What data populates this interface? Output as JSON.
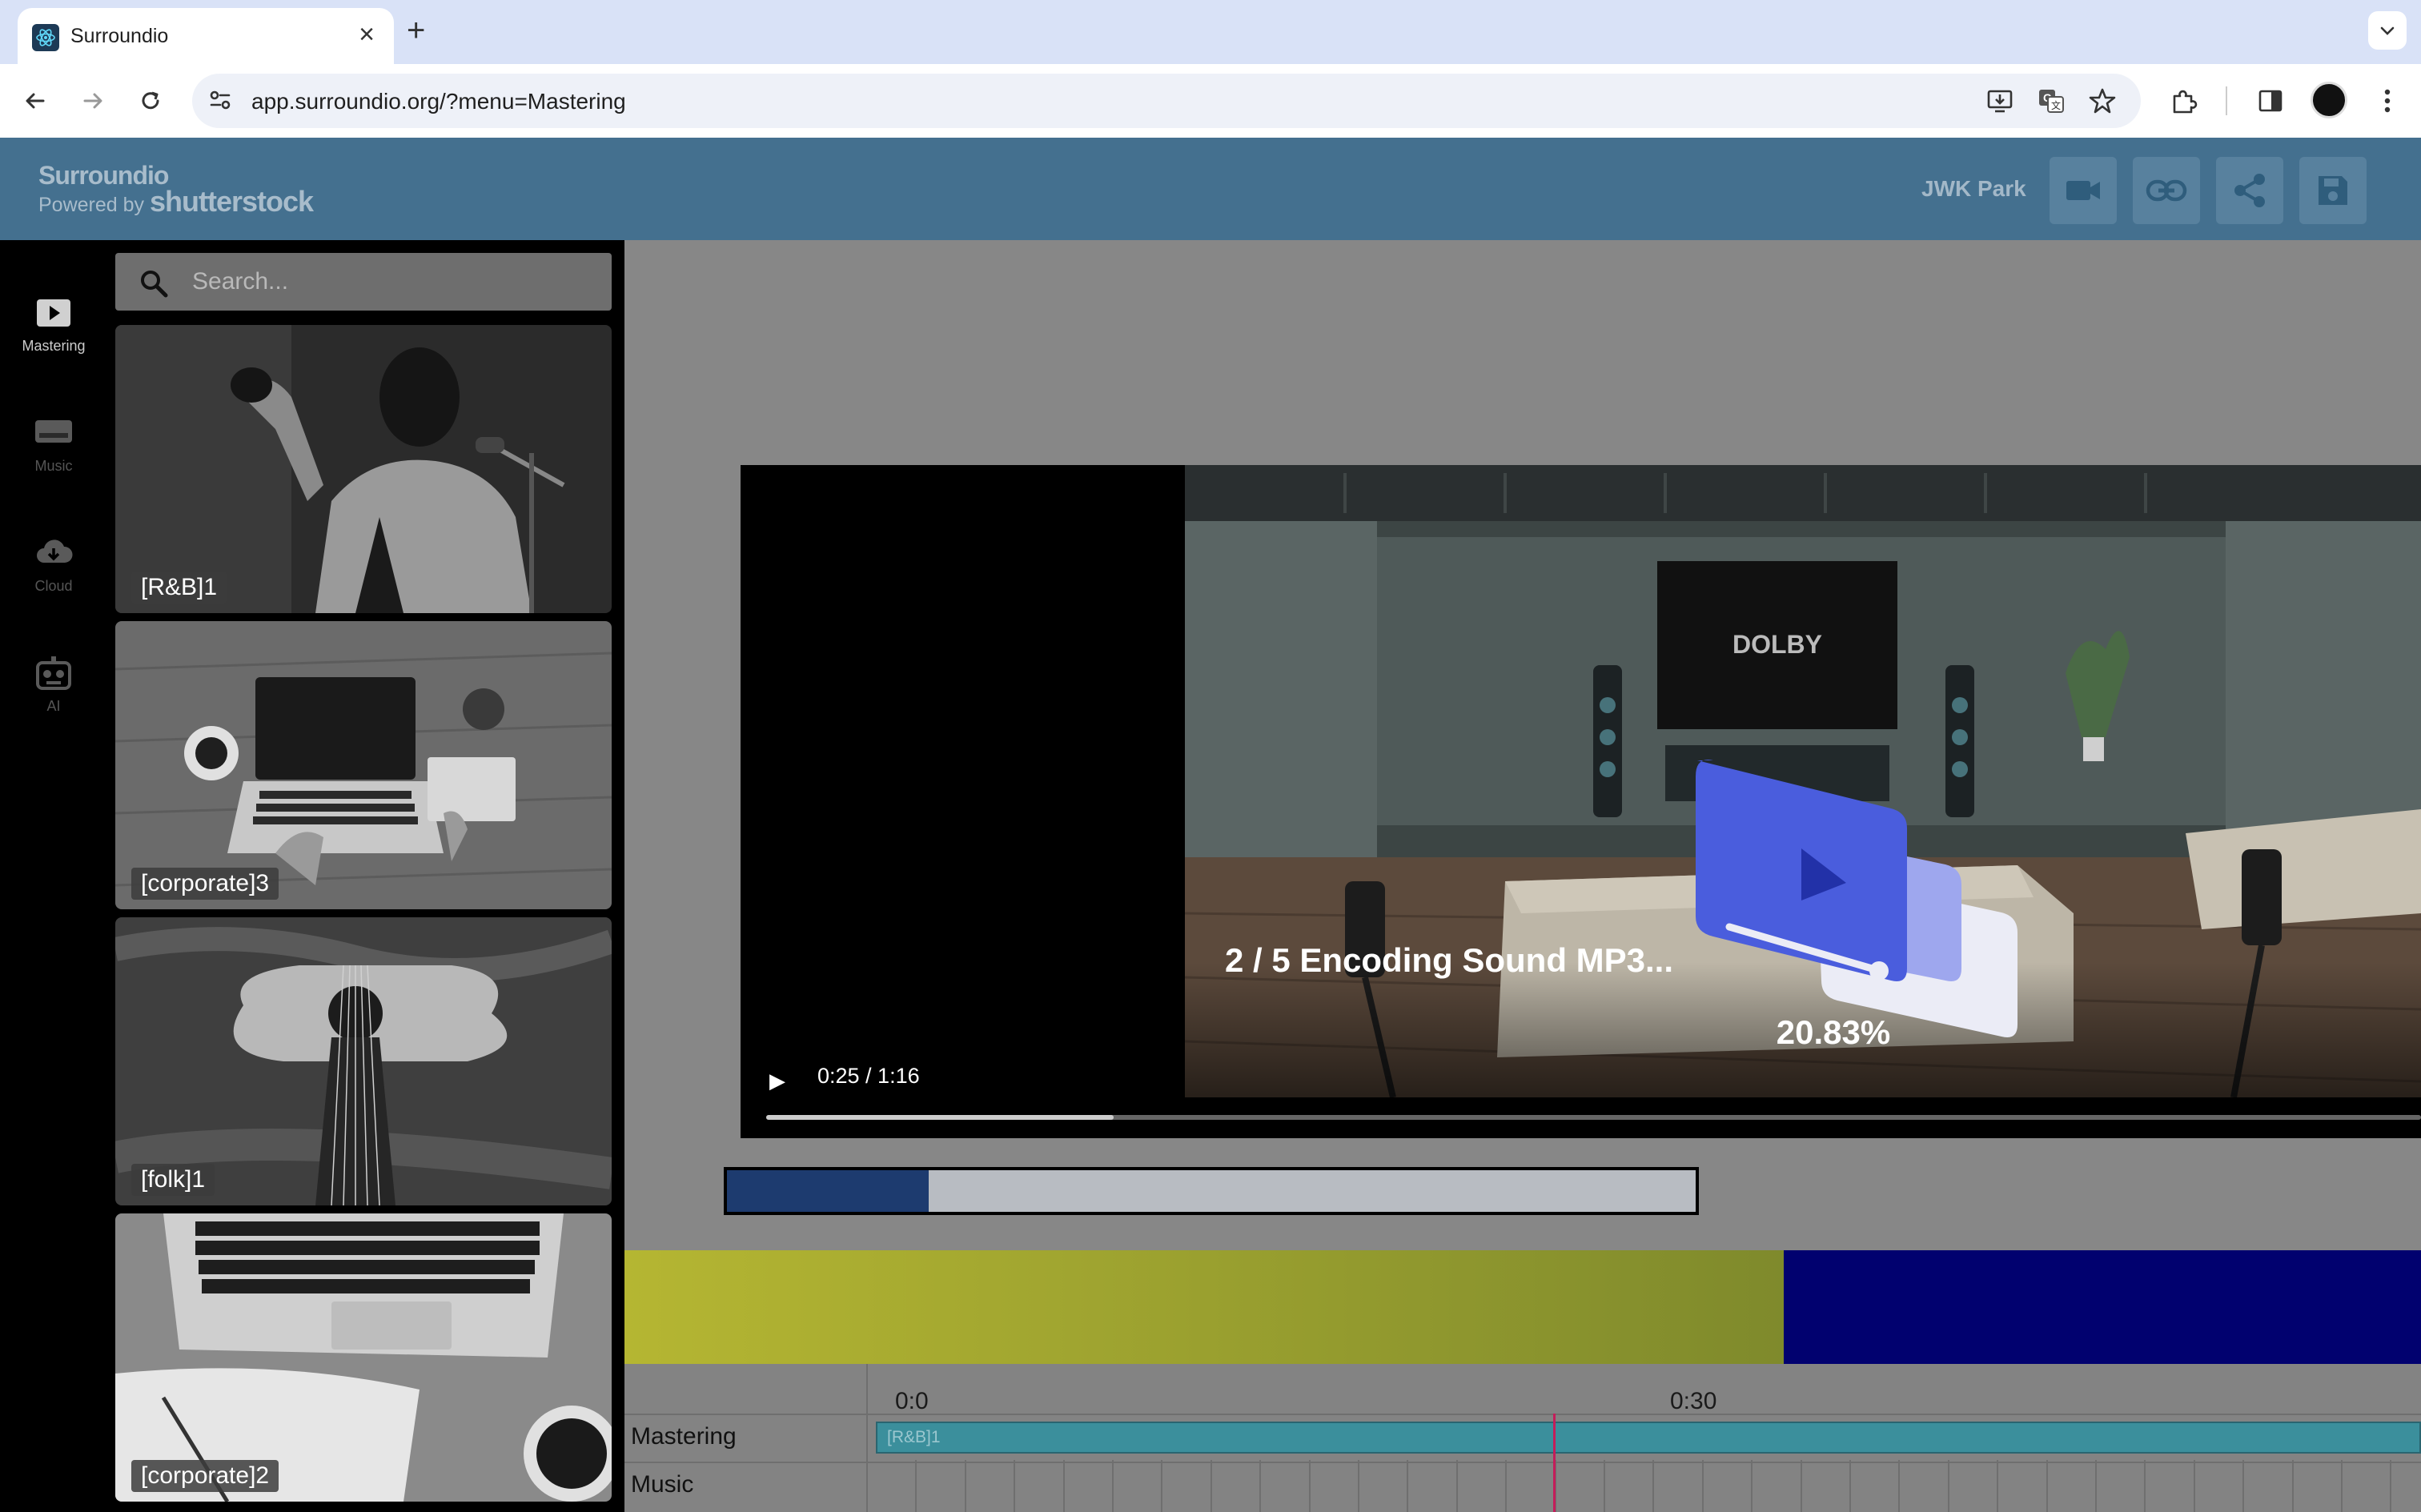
{
  "browser": {
    "tab_title": "Surroundio",
    "url": "app.surroundio.org/?menu=Mastering",
    "new_tab_symbol": "+",
    "close_symbol": "×"
  },
  "header": {
    "brand_name": "Surroundio",
    "brand_sub_prefix": "Powered by",
    "brand_sub_name": "shutterstock",
    "user_name": "JWK Park",
    "colors": {
      "bar": "#44708f",
      "button": "#58819e"
    }
  },
  "rail": {
    "items": [
      {
        "label": "Mastering",
        "icon": "play-square-icon",
        "active": true
      },
      {
        "label": "Music",
        "icon": "music-box-icon",
        "active": false
      },
      {
        "label": "Cloud",
        "icon": "cloud-download-icon",
        "active": false
      },
      {
        "label": "AI",
        "icon": "robot-icon",
        "active": false
      }
    ]
  },
  "library": {
    "search_placeholder": "Search...",
    "cards": [
      {
        "label": "[R&B]1",
        "picture": "singer-at-microphone"
      },
      {
        "label": "[corporate]3",
        "picture": "laptop-on-desk"
      },
      {
        "label": "[folk]1",
        "picture": "acoustic-guitar"
      },
      {
        "label": "[corporate]2",
        "picture": "keyboard-and-notebook"
      }
    ]
  },
  "player": {
    "time": "0:25 / 1:16",
    "seek_progress": 0.21,
    "brand_on_screen": "DOLBY"
  },
  "encoding": {
    "status": "2 / 5 Encoding Sound MP3...",
    "percent": "20.83%",
    "progress": 0.2083
  },
  "tracks": {
    "colors": {
      "primary": "#b5b632",
      "secondary": "#01016f"
    }
  },
  "timeline": {
    "ruler": [
      "0:0",
      "0:30"
    ],
    "rows": [
      "Mastering",
      "Music"
    ],
    "clip_label": "[R&B]1",
    "playhead_color": "#c41d5a"
  }
}
